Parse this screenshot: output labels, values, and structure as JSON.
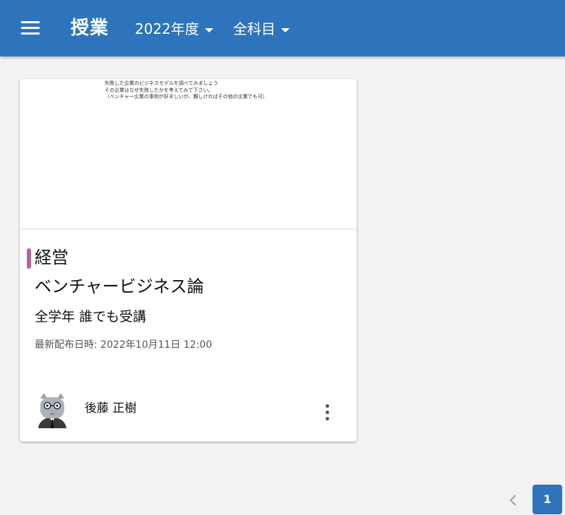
{
  "appbar": {
    "title": "授業",
    "year_filter": "2022年度",
    "subject_filter": "全科目",
    "color": "#2e74bd"
  },
  "card": {
    "preview_lines": [
      "失敗した企業のビジネスモデルを調べてみましょう",
      "その企業はなぜ失敗したかを考えてみて下さい。",
      "（ベンチャー企業の事例が好ましいが、難しければその他の企業でも可）"
    ],
    "category": "経営",
    "category_color": "#b3629e",
    "title": "ベンチャービジネス論",
    "audience": "全学年 誰でも受講",
    "updated": "最新配布日時: 2022年10月11日 12:00",
    "teacher": "後藤 正樹",
    "avatar_icon": "cat-avatar-icon",
    "more_icon": "more-vert-icon"
  },
  "pagination": {
    "prev_icon": "chevron-left-icon",
    "current_page": "1"
  }
}
